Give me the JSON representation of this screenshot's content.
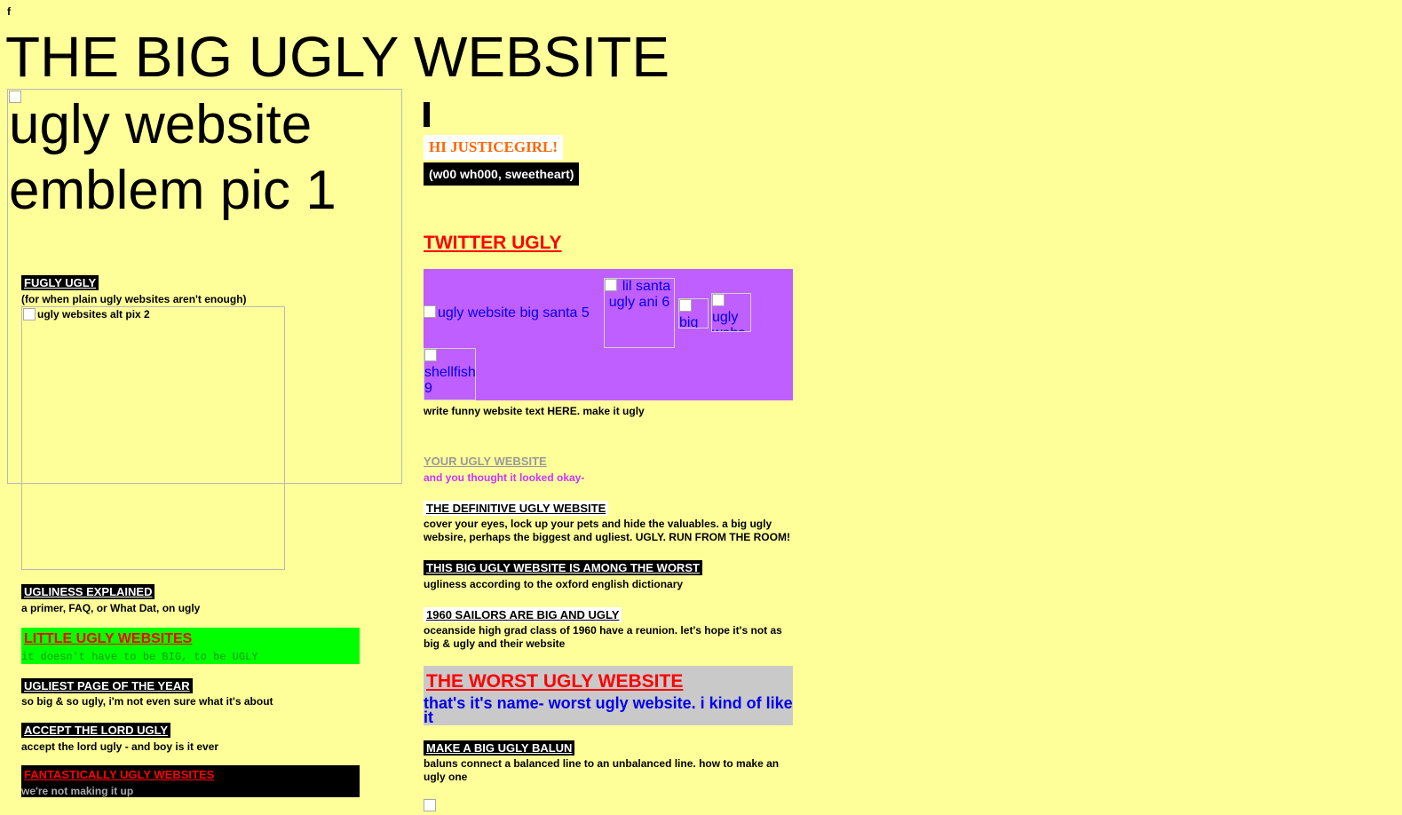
{
  "tiny_letter": "f",
  "site_title": "THE BIG UGLY WEBSITE",
  "emblem_alt": "ugly website emblem pic 1",
  "left_column": {
    "fugly": {
      "title": "FUGLY UGLY",
      "desc": "(for when plain ugly websites aren't enough)"
    },
    "alt_pix_2": "ugly websites alt pix 2",
    "explained": {
      "title": "UGLINESS EXPLAINED",
      "desc": "a primer, FAQ, or What Dat, on ugly"
    },
    "little": {
      "title": "LITTLE UGLY WEBSITES",
      "desc": "it doesn't have to be BIG, to be UGLY"
    },
    "ugliest": {
      "title": "UGLIEST PAGE OF THE YEAR",
      "desc": "so big & so ugly, i'm not even sure what it's about"
    },
    "lord": {
      "title": "ACCEPT THE LORD UGLY",
      "desc": "accept the lord ugly - and boy is it ever"
    },
    "fantastically": {
      "title": "FANTASTICALLY UGLY WEBSITES",
      "desc": "we're not making it up"
    }
  },
  "right_column": {
    "hi": "HI JUSTICEGIRL!",
    "woo": "(w00 wh000, sweetheart)",
    "twitter": "TWITTER UGLY",
    "images": {
      "santa5": "ugly website big santa 5",
      "santa6": "lil santa ugly ani 6",
      "big": "big",
      "webs": "ugly webs",
      "shellfish": "shellfish 9"
    },
    "funny_text": "write funny website text HERE. make it ugly",
    "your": {
      "title": "YOUR UGLY WEBSITE",
      "desc": "and you thought it looked okay-"
    },
    "definitive": {
      "title": "THE DEFINITIVE UGLY WEBSITE",
      "desc": "cover your eyes, lock up your pets and hide the valuables. a big ugly websire, perhaps the biggest and ugliest. UGLY. RUN FROM THE ROOM!"
    },
    "among": {
      "title": "THIS BIG UGLY WEBSITE IS AMONG THE WORST",
      "desc": "ugliness according to the oxford english dictionary"
    },
    "sailors": {
      "title": "1960 SAILORS ARE BIG AND UGLY",
      "desc": "oceanside high grad class of 1960 have a reunion. let's hope it's not as big & ugly and their website"
    },
    "worst": {
      "title": "THE WORST UGLY WEBSITE",
      "desc": "that's it's name- worst ugly website. i kind of like it"
    },
    "balun": {
      "title": "MAKE A BIG UGLY BALUN",
      "desc": "baluns connect a balanced line to an unbalanced line. how to make an ugly one"
    }
  },
  "colors": {
    "page_bg": "#ffff99",
    "green_block": "#00ff00",
    "purple_block": "#bf5fff",
    "gray_block": "#c9c9c9",
    "red_text": "#ff0000",
    "orange_text": "#ff6600",
    "link_blue": "#0000ee",
    "magenta_text": "#cc33ff"
  }
}
